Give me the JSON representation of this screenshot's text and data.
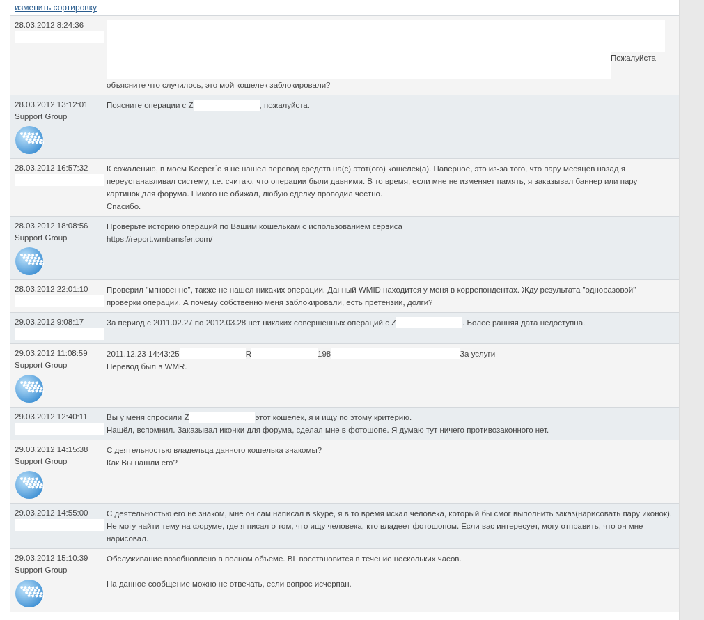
{
  "sort_link": "изменить сортировку",
  "messages": [
    {
      "date": "28.03.2012 8:24:36",
      "sender": {
        "kind": "user"
      },
      "lines": [
        [
          {
            "kind": "redacted_area"
          }
        ],
        [
          {
            "kind": "redacted_span"
          },
          {
            "kind": "text",
            "text": "Пожалуйста"
          }
        ],
        [
          {
            "kind": "text",
            "text": "объясните что случилось, это мой кошелек заблокировали?"
          }
        ]
      ]
    },
    {
      "date": "28.03.2012 13:12:01",
      "sender": {
        "kind": "support",
        "name": "Support Group"
      },
      "lines": [
        [
          {
            "kind": "text",
            "text": "Поясните операции с Z"
          },
          {
            "kind": "redacted"
          },
          {
            "kind": "text",
            "text": ", пожалуйста."
          }
        ]
      ]
    },
    {
      "date": "28.03.2012 16:57:32",
      "sender": {
        "kind": "user"
      },
      "lines": [
        [
          {
            "kind": "text",
            "text": "К сожалению, в моем Keeper´е я не нашёл перевод средств на(с) этот(ого) кошелёк(а). Наверное, это из-за того, что пару месяцев назад я переустанавливал систему, т.е. считаю, что операции были давними. В то время, если мне не изменяет память, я заказывал баннер или пару картинок для форума. Никого не обижал, любую сделку проводил честно."
          }
        ],
        [
          {
            "kind": "text",
            "text": "Спасибо."
          }
        ]
      ]
    },
    {
      "date": "28.03.2012 18:08:56",
      "sender": {
        "kind": "support",
        "name": "Support Group"
      },
      "lines": [
        [
          {
            "kind": "text",
            "text": "Проверьте историю операций по Вашим кошелькам с использованием сервиса"
          }
        ],
        [
          {
            "kind": "text",
            "text": "https://report.wmtransfer.com/"
          }
        ]
      ]
    },
    {
      "date": "28.03.2012 22:01:10",
      "sender": {
        "kind": "user"
      },
      "lines": [
        [
          {
            "kind": "text",
            "text": "Проверил \"мгновенно\", также не нашел никаких операции. Данный WMID находится у меня в коррепондентах. Жду результата \"одноразовой\" проверки операции. А почему собственно меня заблокировали, есть претензии, долги?"
          }
        ]
      ]
    },
    {
      "date": "29.03.2012 9:08:17",
      "sender": {
        "kind": "user"
      },
      "lines": [
        [
          {
            "kind": "text",
            "text": "За период с 2011.02.27 по 2012.03.28 нет никаких совершенных операций с Z"
          },
          {
            "kind": "redacted"
          },
          {
            "kind": "text",
            "text": ". Более ранняя дата недоступна."
          }
        ]
      ]
    },
    {
      "date": "29.03.2012 11:08:59",
      "sender": {
        "kind": "support",
        "name": "Support Group"
      },
      "lines": [
        [
          {
            "kind": "text",
            "text": "2011.12.23 14:43:25"
          },
          {
            "kind": "redacted"
          },
          {
            "kind": "text",
            "text": "R"
          },
          {
            "kind": "redacted"
          },
          {
            "kind": "text",
            "text": "198"
          },
          {
            "kind": "redacted_long"
          },
          {
            "kind": "text",
            "text": "За услуги"
          }
        ],
        [
          {
            "kind": "text",
            "text": "Перевод был в WMR."
          }
        ]
      ]
    },
    {
      "date": "29.03.2012 12:40:11",
      "sender": {
        "kind": "user"
      },
      "lines": [
        [
          {
            "kind": "text",
            "text": "Вы у меня спросили Z"
          },
          {
            "kind": "redacted"
          },
          {
            "kind": "text",
            "text": "этот кошелек, я и ищу по этому критерию."
          }
        ],
        [
          {
            "kind": "text",
            "text": "Нашёл, вспомнил. Заказывал иконки для форума, сделал мне в фотошопе. Я думаю тут ничего противозаконного нет."
          }
        ]
      ]
    },
    {
      "date": "29.03.2012 14:15:38",
      "sender": {
        "kind": "support",
        "name": "Support Group"
      },
      "lines": [
        [
          {
            "kind": "text",
            "text": "С деятельностью владельца данного кошелька знакомы?"
          }
        ],
        [
          {
            "kind": "text",
            "text": "Как Вы нашли его?"
          }
        ]
      ]
    },
    {
      "date": "29.03.2012 14:55:00",
      "sender": {
        "kind": "user"
      },
      "lines": [
        [
          {
            "kind": "text",
            "text": "С деятельностью его не знаком, мне он сам написал в skype, я в то время искал человека, который бы смог выполнить заказ(нарисовать пару иконок). Не могу найти тему на форуме, где я писал о том, что ищу человека, кто владеет фотошопом. Если вас интересует, могу отправить, что он мне нарисовал."
          }
        ]
      ]
    },
    {
      "date": "29.03.2012 15:10:39",
      "sender": {
        "kind": "support",
        "name": "Support Group"
      },
      "lines": [
        [
          {
            "kind": "text",
            "text": "Обслуживание возобновлено в полном объеме. BL восстановится в течение нескольких часов."
          }
        ],
        [
          {
            "kind": "blank"
          }
        ],
        [
          {
            "kind": "text",
            "text": "На данное сообщение можно не отвечать, если вопрос исчерпан."
          }
        ]
      ]
    }
  ]
}
